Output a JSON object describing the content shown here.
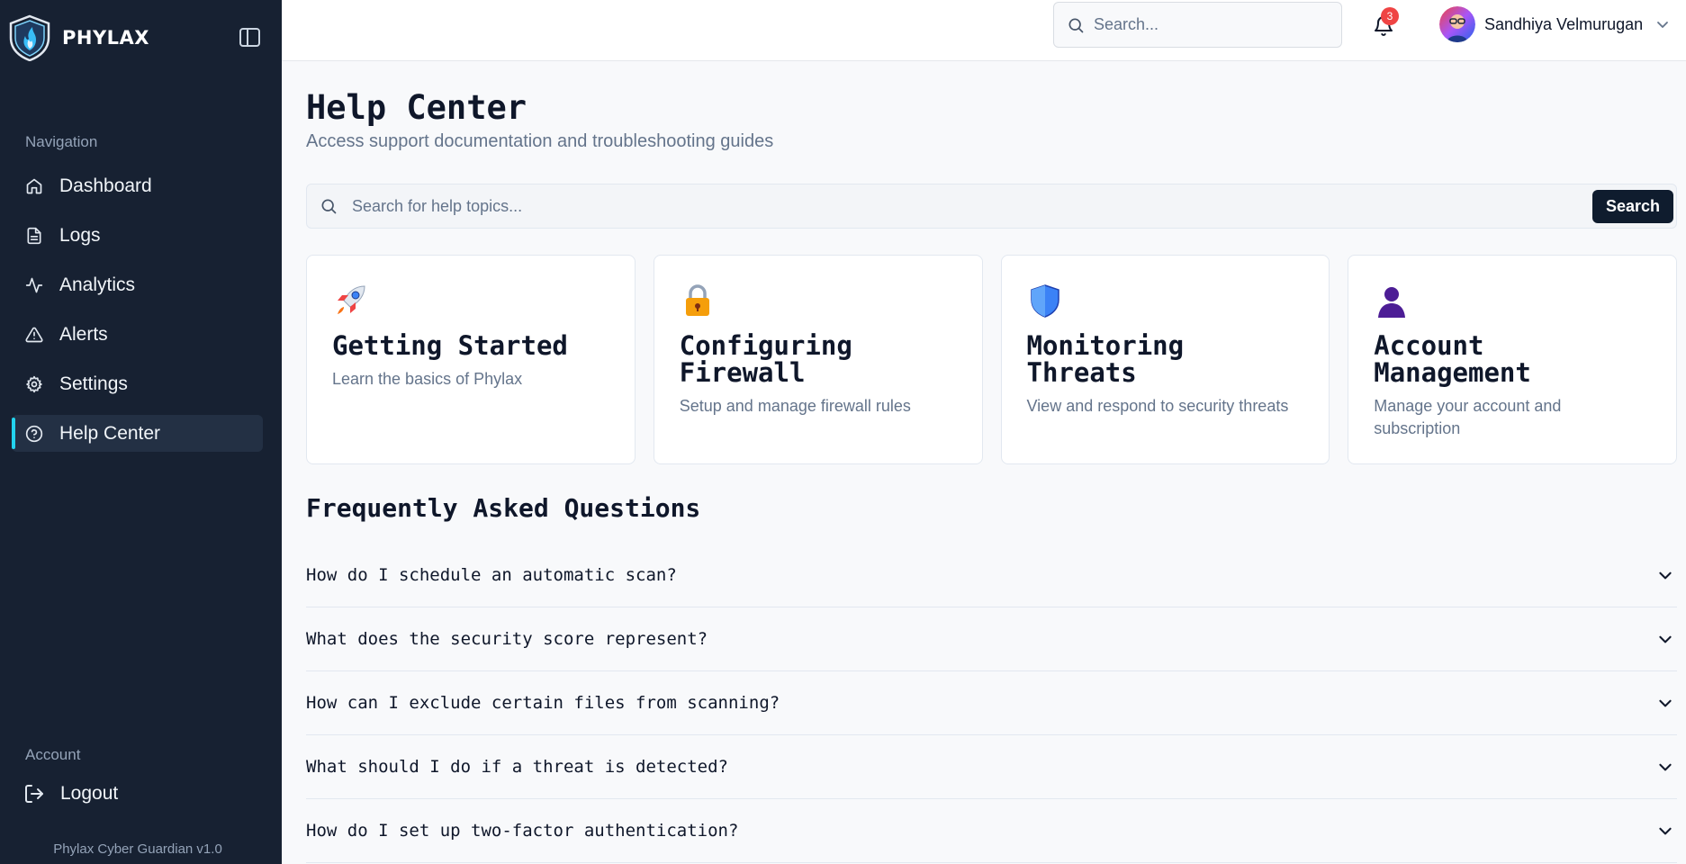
{
  "brand": {
    "name": "PHYLAX"
  },
  "sidebar": {
    "nav_heading": "Navigation",
    "items": [
      {
        "label": "Dashboard",
        "icon": "home-icon"
      },
      {
        "label": "Logs",
        "icon": "file-text-icon"
      },
      {
        "label": "Analytics",
        "icon": "activity-icon"
      },
      {
        "label": "Alerts",
        "icon": "alert-triangle-icon"
      },
      {
        "label": "Settings",
        "icon": "gear-icon"
      },
      {
        "label": "Help Center",
        "icon": "help-circle-icon",
        "active": true
      }
    ],
    "account_heading": "Account",
    "logout_label": "Logout",
    "version": "Phylax Cyber Guardian v1.0"
  },
  "topbar": {
    "search_placeholder": "Search...",
    "notification_count": "3",
    "user_name": "Sandhiya Velmurugan"
  },
  "main": {
    "title": "Help Center",
    "subtitle": "Access support documentation and troubleshooting guides",
    "search_placeholder": "Search for help topics...",
    "search_button": "Search",
    "cards": [
      {
        "icon": "rocket-icon",
        "title": "Getting Started",
        "desc": "Learn the basics of Phylax"
      },
      {
        "icon": "lock-icon",
        "title": "Configuring Firewall",
        "desc": "Setup and manage firewall rules"
      },
      {
        "icon": "shield-icon",
        "title": "Monitoring Threats",
        "desc": "View and respond to security threats"
      },
      {
        "icon": "user-silhouette-icon",
        "title": "Account Management",
        "desc": "Manage your account and subscription"
      }
    ],
    "faq_title": "Frequently Asked Questions",
    "faqs": [
      "How do I schedule an automatic scan?",
      "What does the security score represent?",
      "How can I exclude certain files from scanning?",
      "What should I do if a threat is detected?",
      "How do I set up two-factor authentication?"
    ]
  },
  "colors": {
    "sidebar_bg": "#172132",
    "accent": "#22d3ee",
    "button_bg": "#0f1c2e",
    "badge": "#ef4444"
  }
}
